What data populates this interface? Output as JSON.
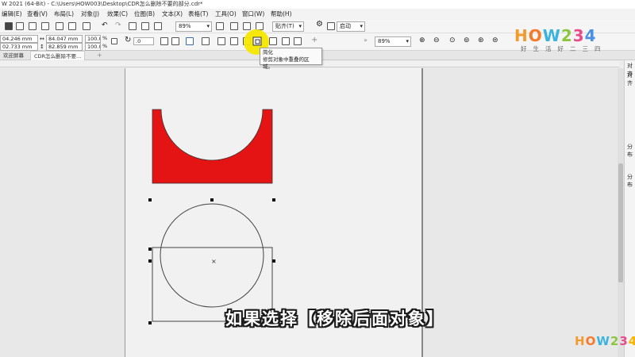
{
  "window": {
    "title": "W 2021 (64-Bit) - C:\\Users\\HOW003\\Desktop\\CDR怎么删除不要的部分.cdr*"
  },
  "menu": [
    "编辑(E)",
    "查看(V)",
    "布局(L)",
    "对象(J)",
    "效果(C)",
    "位图(B)",
    "文本(X)",
    "表格(T)",
    "工具(O)",
    "窗口(W)",
    "帮助(H)"
  ],
  "toolbar": {
    "zoom": "89%",
    "snap_label": "贴齐(T)",
    "launch_label": "启动"
  },
  "property_bar": {
    "x": "04.246 mm",
    "y": "02.733 mm",
    "width": "84.047 mm",
    "height": "82.859 mm",
    "scale_x": "100.0",
    "scale_y": "100.0",
    "percent": "%",
    "rotation": ".0",
    "zoom": "89%"
  },
  "tabs": [
    "欢迎屏幕",
    "CDR怎么删除不要..."
  ],
  "tooltip": {
    "title": "简化",
    "description": "修剪对象中重叠的区域。"
  },
  "right_panel": {
    "labels": [
      "对齐",
      "对齐",
      "分布",
      "分布"
    ]
  },
  "caption": "如果选择【移除后面对象】",
  "logo": {
    "word": "HOW234",
    "sub": "好生活好二三四"
  },
  "watermark": "HOW234",
  "colors": {
    "shape_fill": "#e51414",
    "highlight": "#f5e600"
  }
}
